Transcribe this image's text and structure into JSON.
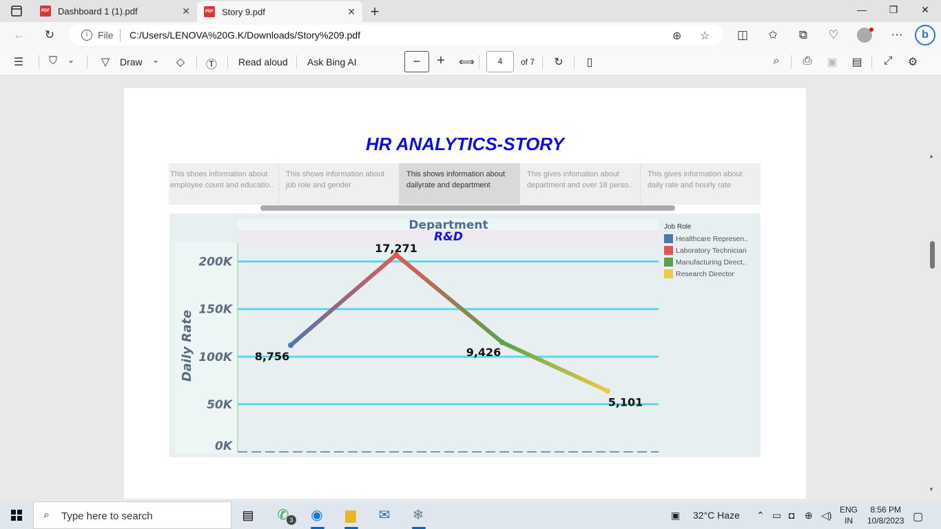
{
  "browser": {
    "tabs": [
      {
        "title": "Dashboard 1 (1).pdf",
        "active": false
      },
      {
        "title": "Story 9.pdf",
        "active": true
      }
    ],
    "file_label": "File",
    "url": "C:/Users/LENOVA%20G.K/Downloads/Story%209.pdf"
  },
  "pdf_toolbar": {
    "draw_label": "Draw",
    "read_aloud_label": "Read aloud",
    "ask_bing_label": "Ask Bing AI",
    "page_number": "4",
    "page_total": "of 7"
  },
  "story": {
    "title": "HR ANALYTICS-STORY",
    "points": [
      {
        "line1": "This shoes information about",
        "line2": "employee count and educatio.."
      },
      {
        "line1": "This shows information about",
        "line2": "job role and gender"
      },
      {
        "line1": "This shows information about",
        "line2": "dailyrate and department"
      },
      {
        "line1": "This gives infomation about",
        "line2": "department and over 18 perso.."
      },
      {
        "line1": "This gives information about",
        "line2": "daily rate and hourly rate"
      }
    ],
    "active_point": 2
  },
  "chart_data": {
    "type": "line",
    "column_header": "Department",
    "column_value": "R&D",
    "ylabel": "Daily Rate",
    "ylim": [
      0,
      220000
    ],
    "y_ticks": [
      0,
      50000,
      100000,
      150000,
      200000
    ],
    "y_tick_labels": [
      "0K",
      "50K",
      "100K",
      "150K",
      "200K"
    ],
    "x_positions": [
      1,
      2,
      3,
      4
    ],
    "values": [
      112000,
      207000,
      115000,
      64000
    ],
    "data_labels": [
      "8,756",
      "17,271",
      "9,426",
      "5,101"
    ],
    "series_colors": [
      "#4e79a7",
      "#e15759",
      "#59a14f",
      "#edc948"
    ],
    "legend_title": "Job Role",
    "legend": [
      {
        "name": "Healthcare Represen..",
        "color": "#4e79a7"
      },
      {
        "name": "Laboratory Technician",
        "color": "#e15759"
      },
      {
        "name": "Manufacturing Direct..",
        "color": "#59a14f"
      },
      {
        "name": "Research Director",
        "color": "#edc948"
      }
    ],
    "grid": true
  },
  "taskbar": {
    "search_placeholder": "Type here to search",
    "whatsapp_badge": "3",
    "weather": "32°C  Haze",
    "lang_line1": "ENG",
    "lang_line2": "IN",
    "time": "8:56 PM",
    "date": "10/8/2023"
  }
}
